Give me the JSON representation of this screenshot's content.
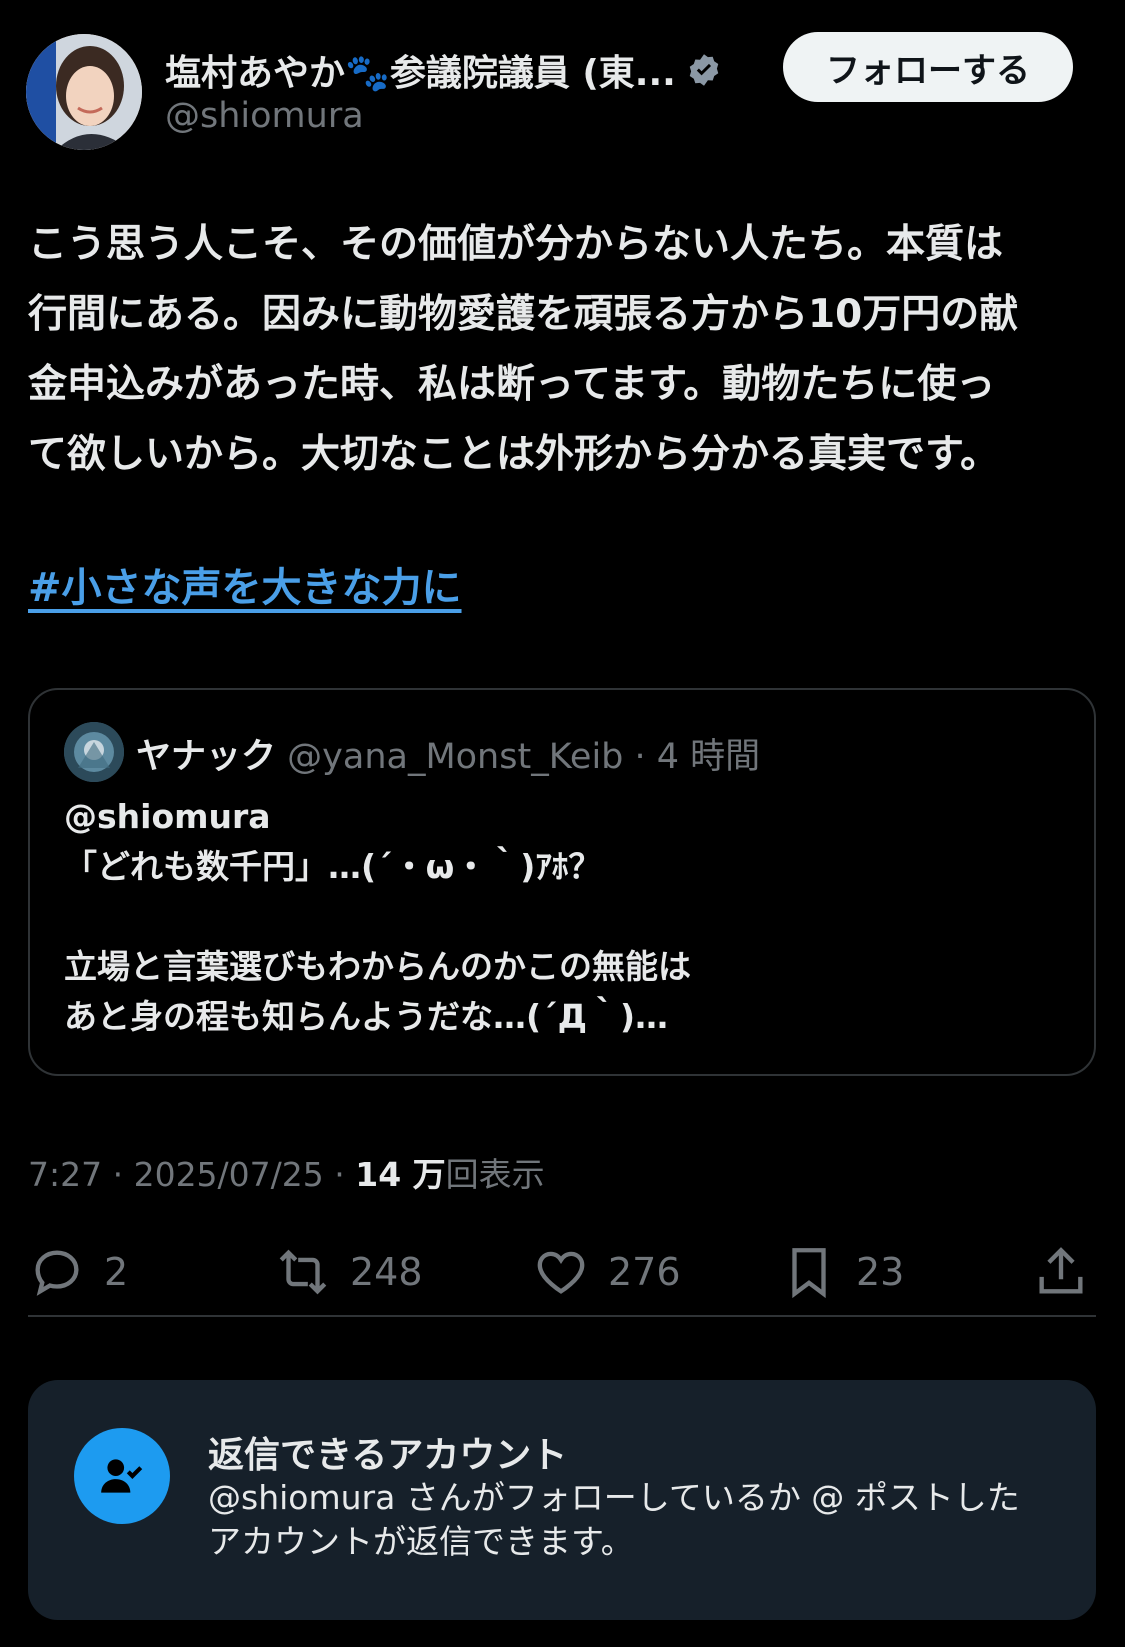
{
  "author": {
    "display_name": "塩村あやか🐾参議院議員 (東...",
    "handle": "@shiomura",
    "verified": true,
    "avatar_icon": "profile-photo"
  },
  "follow_button": {
    "label": "フォローする"
  },
  "tweet": {
    "lines": [
      "こう思う人こそ、その価値が分からない人たち。本質は",
      "行間にある。因みに動物愛護を頑張る方から10万円の献",
      "金申込みがあった時、私は断ってます。動物たちに使っ",
      "て欲しいから。大切なことは外形から分かる真実です。"
    ],
    "hashtag": "#小さな声を大きな力に"
  },
  "quote": {
    "name": "ヤナック",
    "meta": "@yana_Monst_Keib · 4 時間",
    "lines": [
      "@shiomura",
      "「どれも数千円」…(´・ω・｀)ｱﾎ？",
      "",
      "立場と言葉選びもわからんのかこの無能は",
      "あと身の程も知らんようだな…(´Д｀)…"
    ]
  },
  "meta": {
    "time_date": "7:27 · 2025/07/25 · ",
    "views_count": "14 万",
    "views_label": "回表示"
  },
  "actions": {
    "reply_count": "2",
    "repost_count": "248",
    "like_count": "276",
    "bookmark_count": "23"
  },
  "reply_restriction": {
    "title": "返信できるアカウント",
    "desc_lines": [
      "@shiomura さんがフォローしているか @ ポストした",
      "アカウントが返信できます。"
    ]
  },
  "colors": {
    "background": "#000000",
    "text": "#e7e9ea",
    "secondary": "#71767b",
    "link": "#4a9fe8",
    "accent": "#1d9bf0"
  }
}
